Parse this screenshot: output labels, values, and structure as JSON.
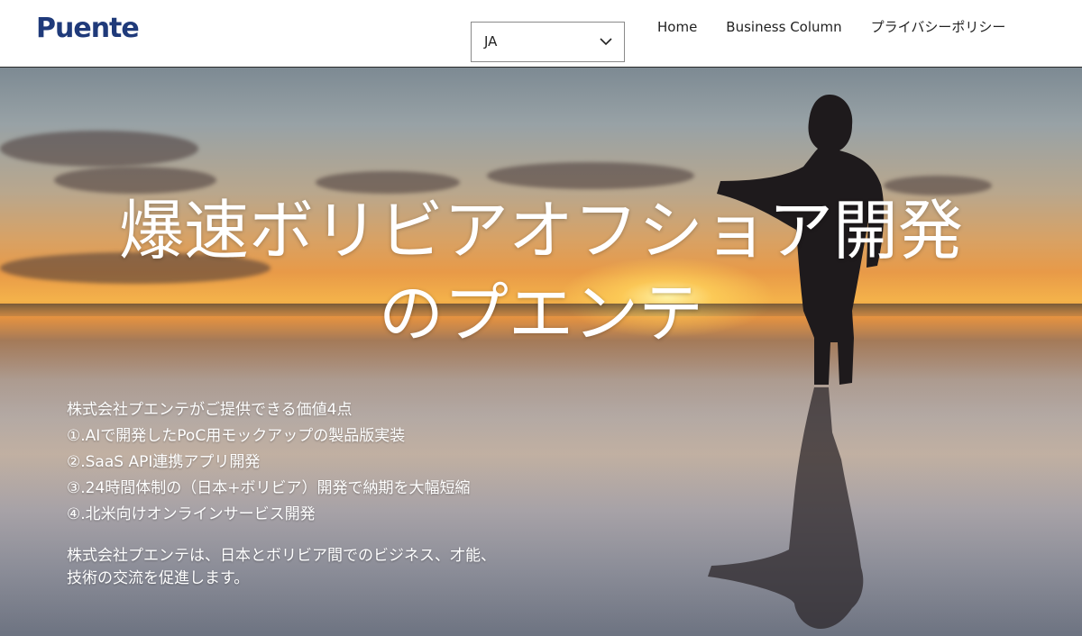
{
  "header": {
    "logo_text": "Puente",
    "language_select": {
      "value": "JA"
    },
    "nav": [
      {
        "label": "Home"
      },
      {
        "label": "Business Column"
      },
      {
        "label": "プライバシーポリシー"
      }
    ]
  },
  "hero": {
    "title_line1": "爆速ボリビアオフショア開発",
    "title_line2": "のプエンテ",
    "values": {
      "heading": "株式会社プエンテがご提供できる価値4点",
      "items": [
        "①.AIで開発したPoC用モックアップの製品版実装",
        "②.SaaS API連携アプリ開発",
        "③.24時間体制の（日本+ボリビア）開発で納期を大幅短縮",
        "④.北米向けオンラインサービス開発"
      ]
    },
    "about": {
      "line1": "株式会社プエンテは、日本とボリビア間でのビジネス、才能、",
      "line2": "技術の交流を促進します。"
    }
  },
  "colors": {
    "logo_blue": "#1f3a7a",
    "logo_green": "#6db33f",
    "header_bg": "#ffffff",
    "hero_text": "#ffffff"
  }
}
